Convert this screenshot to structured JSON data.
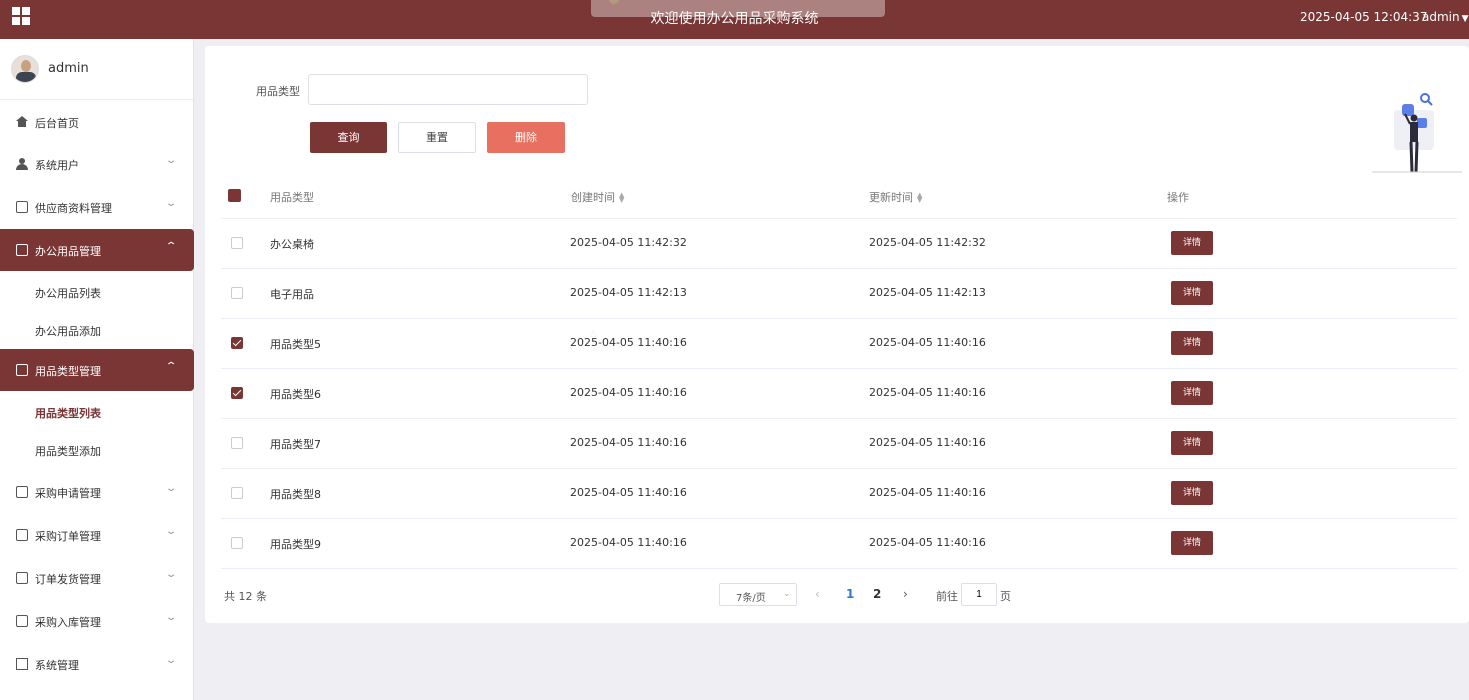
{
  "header": {
    "title": "欢迎使用办公用品采购系统",
    "datetime": "2025-04-05 12:04:37",
    "user": "admin"
  },
  "sidebar": {
    "profile_name": "admin",
    "items": [
      {
        "label": "后台首页",
        "icon": "home-icon"
      },
      {
        "label": "系统用户",
        "icon": "user-icon"
      },
      {
        "label": "供应商资料管理",
        "icon": "document-icon"
      },
      {
        "label": "办公用品管理",
        "icon": "document-icon",
        "sub": [
          "办公用品列表",
          "办公用品添加"
        ]
      },
      {
        "label": "用品类型管理",
        "icon": "document-icon",
        "sub": [
          "用品类型列表",
          "用品类型添加"
        ]
      },
      {
        "label": "采购申请管理",
        "icon": "document-icon"
      },
      {
        "label": "采购订单管理",
        "icon": "document-icon"
      },
      {
        "label": "订单发货管理",
        "icon": "document-icon"
      },
      {
        "label": "采购入库管理",
        "icon": "document-icon"
      },
      {
        "label": "系统管理",
        "icon": "image-icon"
      }
    ]
  },
  "search": {
    "label": "用品类型",
    "value": "",
    "placeholder": ""
  },
  "buttons": {
    "query": "查询",
    "reset": "重置",
    "delete": "删除"
  },
  "table": {
    "headers": {
      "name": "用品类型",
      "created": "创建时间",
      "updated": "更新时间",
      "actions": "操作"
    },
    "detail_label": "详情",
    "rows": [
      {
        "name": "办公桌椅",
        "created": "2025-04-05 11:42:32",
        "updated": "2025-04-05 11:42:32",
        "checked": false
      },
      {
        "name": "电子用品",
        "created": "2025-04-05 11:42:13",
        "updated": "2025-04-05 11:42:13",
        "checked": false
      },
      {
        "name": "用品类型5",
        "created": "2025-04-05 11:40:16",
        "updated": "2025-04-05 11:40:16",
        "checked": true
      },
      {
        "name": "用品类型6",
        "created": "2025-04-05 11:40:16",
        "updated": "2025-04-05 11:40:16",
        "checked": true
      },
      {
        "name": "用品类型7",
        "created": "2025-04-05 11:40:16",
        "updated": "2025-04-05 11:40:16",
        "checked": false
      },
      {
        "name": "用品类型8",
        "created": "2025-04-05 11:40:16",
        "updated": "2025-04-05 11:40:16",
        "checked": false
      },
      {
        "name": "用品类型9",
        "created": "2025-04-05 11:40:16",
        "updated": "2025-04-05 11:40:16",
        "checked": false
      }
    ]
  },
  "pagination": {
    "total": "共 12 条",
    "page_size": "7条/页",
    "pages": [
      "1",
      "2"
    ],
    "current_page": "1",
    "goto_label": "前往",
    "goto_value": "1",
    "page_unit": "页"
  },
  "colors": {
    "primary": "#7a3535",
    "danger": "#e87060",
    "active_page": "#2f7bd0"
  }
}
